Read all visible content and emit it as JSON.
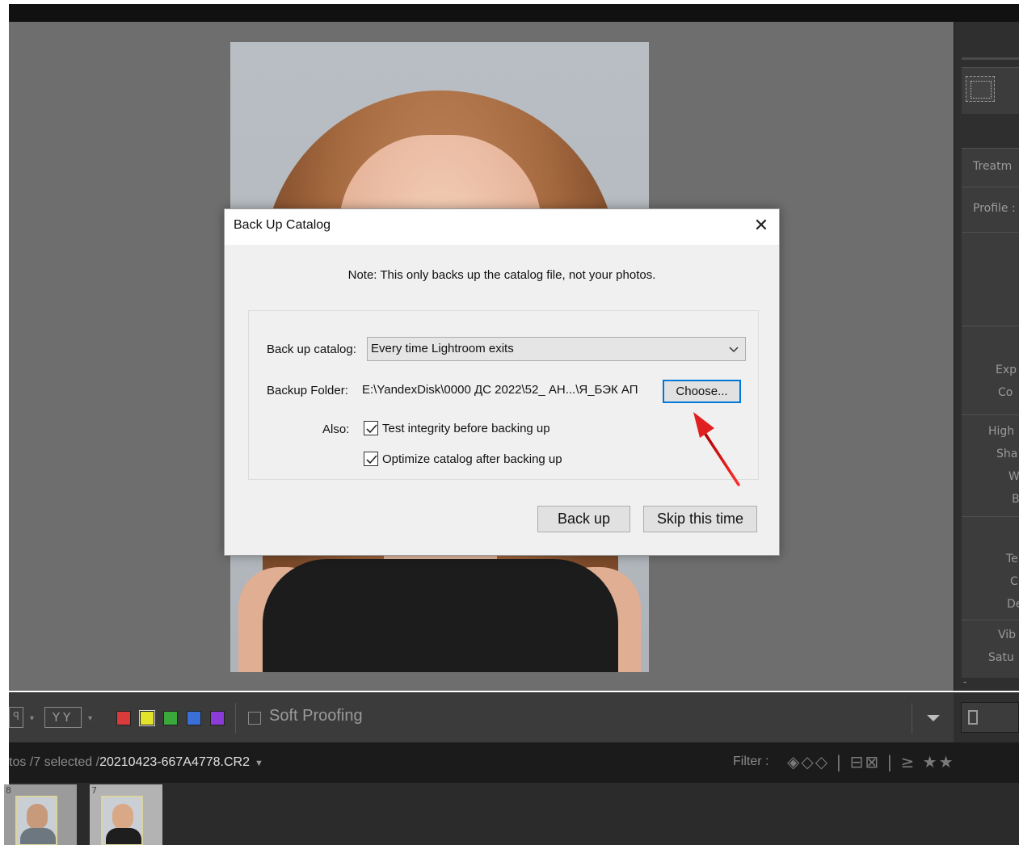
{
  "dialog": {
    "title": "Back Up Catalog",
    "close_glyph": "✕",
    "note": "Note: This only backs up the catalog file, not your photos.",
    "backup_catalog_label": "Back up catalog:",
    "backup_catalog_value": "Every time Lightroom exits",
    "backup_folder_label": "Backup Folder:",
    "backup_folder_path": "E:\\YandexDisk\\0000 ДС 2022\\52_ АН...\\Я_БЭК АП",
    "choose_label": "Choose...",
    "also_label": "Also:",
    "test_integrity_label": "Test integrity before backing up",
    "test_integrity_checked": true,
    "optimize_label": "Optimize catalog after backing up",
    "optimize_checked": true,
    "back_up_label": "Back up",
    "skip_label": "Skip this time",
    "focus_color": "#0078d7"
  },
  "right_panel": {
    "treatment_label": "Treatm",
    "profile_label": "Profile :",
    "tone_labels": [
      "Exp",
      "Co",
      "High",
      "Sha",
      "W",
      "B"
    ],
    "presence_labels": [
      "Te",
      "C",
      "De",
      "Vib",
      "Satu"
    ],
    "misc_mark": "-"
  },
  "toolbar": {
    "flag_glyph": "ꟼ",
    "caret": "▾",
    "yy_label": "YY",
    "color_labels": [
      "#d83b3b",
      "#e3e32b",
      "#3aa83a",
      "#3b6fd8",
      "#8b3bd8"
    ],
    "soft_proofing_label": "Soft Proofing",
    "soft_proofing_checked": false
  },
  "filmbar": {
    "count_text": "tos /7 selected /",
    "file_name": "20210423-667A4778.CR2",
    "caret": "▼",
    "filter_label": "Filter :",
    "filter_icons": "◈◇◇ | ⊟⊠ | ≥ ★★"
  },
  "filmstrip": {
    "thumb_numbers": [
      "8",
      "7"
    ]
  },
  "annotation": {
    "arrow_color": "#e02020"
  }
}
